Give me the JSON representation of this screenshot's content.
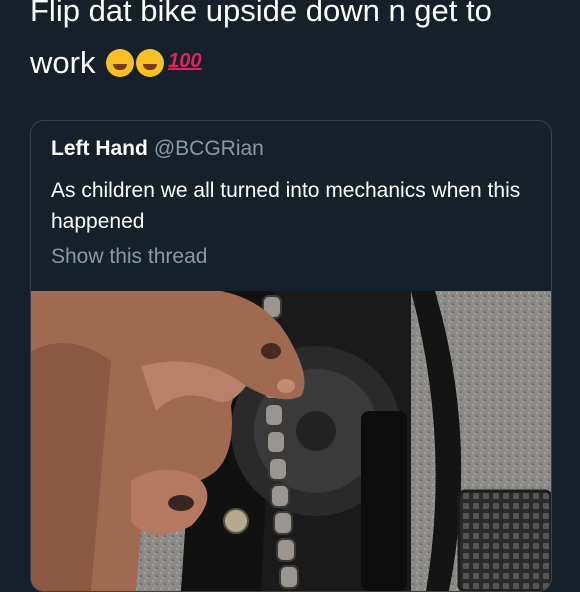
{
  "tweet": {
    "text_line1": "Flip dat bike upside down n get to",
    "text_line2": "work",
    "emojis": [
      "rolling-on-floor-laughing-emoji",
      "rolling-on-floor-laughing-emoji",
      "hundred-points-emoji"
    ],
    "hundred_text": "100"
  },
  "quoted_tweet": {
    "author_name": "Left Hand",
    "author_handle": "@BCGRian",
    "body": "As children we all turned into mechanics when this happened",
    "thread_link": "Show this thread"
  },
  "colors": {
    "background": "#15202b",
    "card_border": "#38444d",
    "secondary_text": "#8899a6",
    "primary_text": "#ffffff"
  }
}
